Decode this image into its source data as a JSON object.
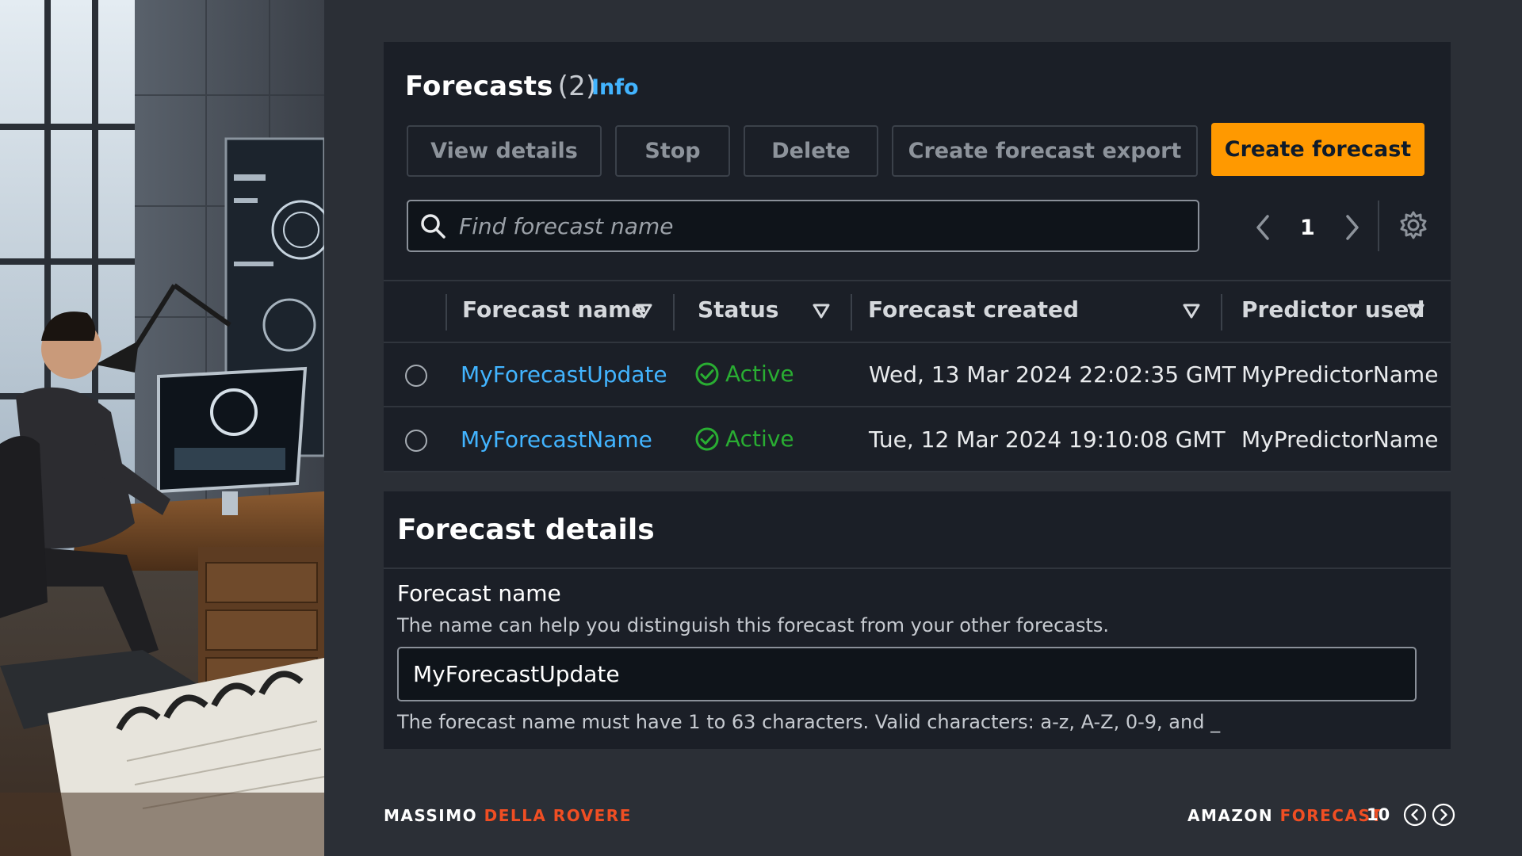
{
  "header": {
    "title": "Forecasts",
    "count": "(2)",
    "info_link": "Info"
  },
  "actions": {
    "view_details": "View details",
    "stop": "Stop",
    "delete": "Delete",
    "create_export": "Create forecast export",
    "create_forecast": "Create forecast"
  },
  "search": {
    "placeholder": "Find forecast name",
    "value": ""
  },
  "pagination": {
    "current_page": "1"
  },
  "table": {
    "columns": [
      "Forecast name",
      "Status",
      "Forecast created",
      "Predictor used"
    ],
    "rows": [
      {
        "name": "MyForecastUpdate",
        "status": "Active",
        "created": "Wed, 13 Mar 2024 22:02:35 GMT",
        "predictor": "MyPredictorName"
      },
      {
        "name": "MyForecastName",
        "status": "Active",
        "created": "Tue, 12 Mar 2024 19:10:08 GMT",
        "predictor": "MyPredictorName"
      }
    ]
  },
  "details": {
    "title": "Forecast details",
    "field_label": "Forecast name",
    "field_description": "The name can help you distinguish this forecast from your other forecasts.",
    "field_value": "MyForecastUpdate",
    "field_constraint": "The forecast name must have 1 to 63 characters. Valid characters: a-z, A-Z, 0-9, and _"
  },
  "footer": {
    "author_first": "MASSIMO",
    "author_last": "DELLA ROVERE",
    "topic_first": "AMAZON",
    "topic_last": "FORECAST",
    "page_number": "10"
  },
  "colors": {
    "primary_button": "#ff9900",
    "link": "#42b4ff",
    "status_active": "#29ad32",
    "accent_footer": "#f04e23",
    "panel_bg": "#1b1f27",
    "page_bg": "#2b2f36"
  },
  "icons": {
    "search": "search-icon",
    "prev": "chevron-left-icon",
    "next": "chevron-right-icon",
    "settings": "gear-icon",
    "sort": "sort-down-icon",
    "status": "check-circle-icon",
    "footer_prev": "circle-chevron-left-icon",
    "footer_next": "circle-chevron-right-icon"
  }
}
